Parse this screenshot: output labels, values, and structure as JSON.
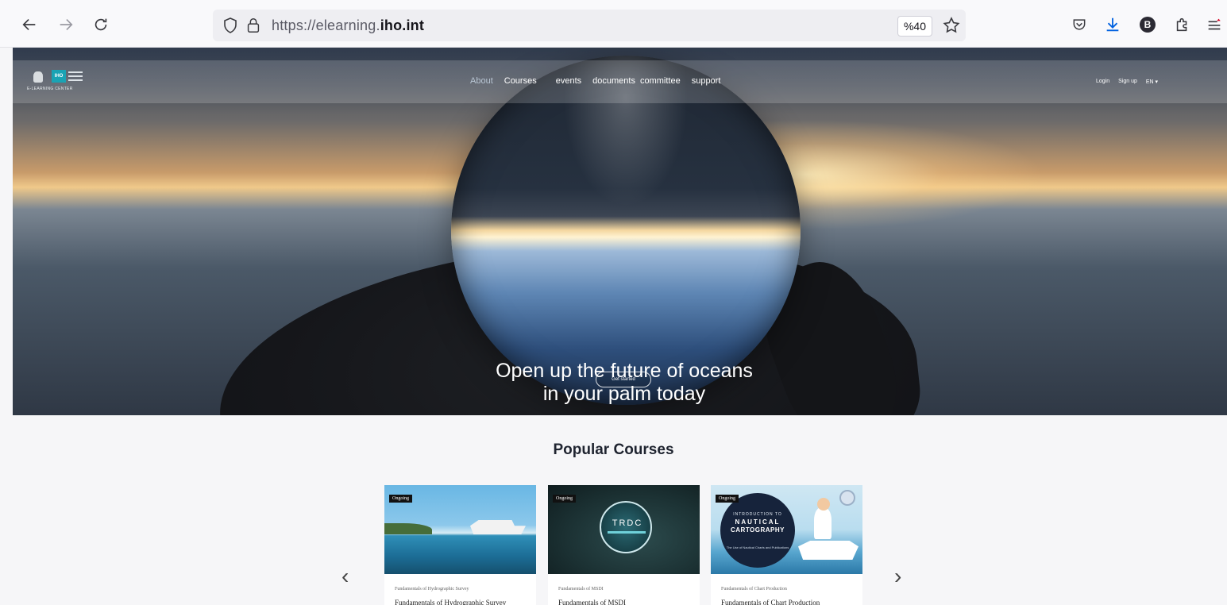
{
  "browser": {
    "url_prefix": "https://elearning.",
    "url_domain": "iho.int",
    "zoom": "%40",
    "avatar_letter": "B"
  },
  "site": {
    "logo_badge": "IHO",
    "logo_subtitle": "E-LEARNING CENTER",
    "nav": [
      "About",
      "Courses",
      "events",
      "documents",
      "committee",
      "support"
    ],
    "account": {
      "login": "Login",
      "signup": "Sign up",
      "lang": "EN ▾"
    },
    "hero_title_line1": "Open up the future of oceans",
    "hero_title_line2": "in your palm today",
    "hero_cta": "Get started"
  },
  "courses": {
    "title": "Popular Courses",
    "prev": "‹",
    "next": "›",
    "items": [
      {
        "tag": "Ongoing",
        "category": "Fundamentals of Hydrographic Survey",
        "name": "Fundamentals of Hydrographic Survey"
      },
      {
        "tag": "Ongoing",
        "category": "Fundamentals of MSDI",
        "name": "Fundamentals of MSDI",
        "image_text": "TRDC"
      },
      {
        "tag": "Ongoing",
        "category": "Fundamentals of Chart Production",
        "name": "Fundamentals of Chart Production",
        "image_lines": [
          "INTRODUCTION TO",
          "NAUTICAL",
          "CARTOGRAPHY",
          "The Use of Nautical Charts and Publications"
        ]
      }
    ]
  },
  "colors": {
    "accent": "#1aa3b4",
    "download": "#0061e0",
    "background": "#f6f6f8"
  }
}
